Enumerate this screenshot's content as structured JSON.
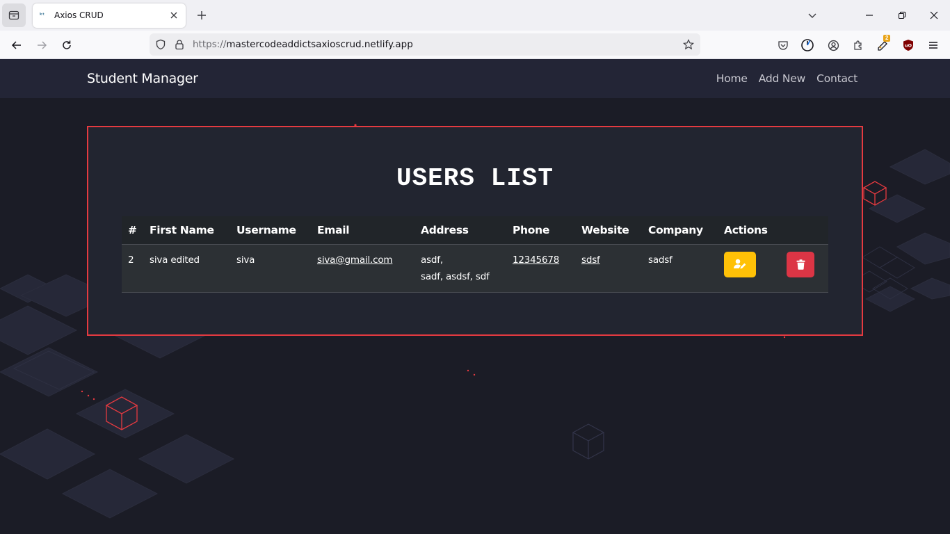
{
  "browser": {
    "tab_title": "Axios CRUD",
    "favicon_text": "ᵏᵗ",
    "url_scheme": "https://",
    "url_host": "mastercodeaddictsaxioscrud.netlify.app",
    "extension_badge": "2"
  },
  "app": {
    "brand": "Student Manager",
    "nav": [
      "Home",
      "Add New",
      "Contact"
    ]
  },
  "users_list": {
    "title": "USERS LIST",
    "columns": [
      "#",
      "First Name",
      "Username",
      "Email",
      "Address",
      "Phone",
      "Website",
      "Company",
      "Actions"
    ],
    "rows": [
      {
        "id": "2",
        "first_name": "siva edited",
        "username": "siva",
        "email": "siva@gmail.com",
        "address_line1": "asdf,",
        "address_line2": "sadf, asdsf, sdf",
        "phone": "12345678",
        "website": "sdsf",
        "company": "sadsf"
      }
    ]
  },
  "colors": {
    "accent_border": "#e53a40",
    "edit_button": "#ffc107",
    "delete_button": "#dc3545",
    "page_background": "#1b1c26"
  }
}
